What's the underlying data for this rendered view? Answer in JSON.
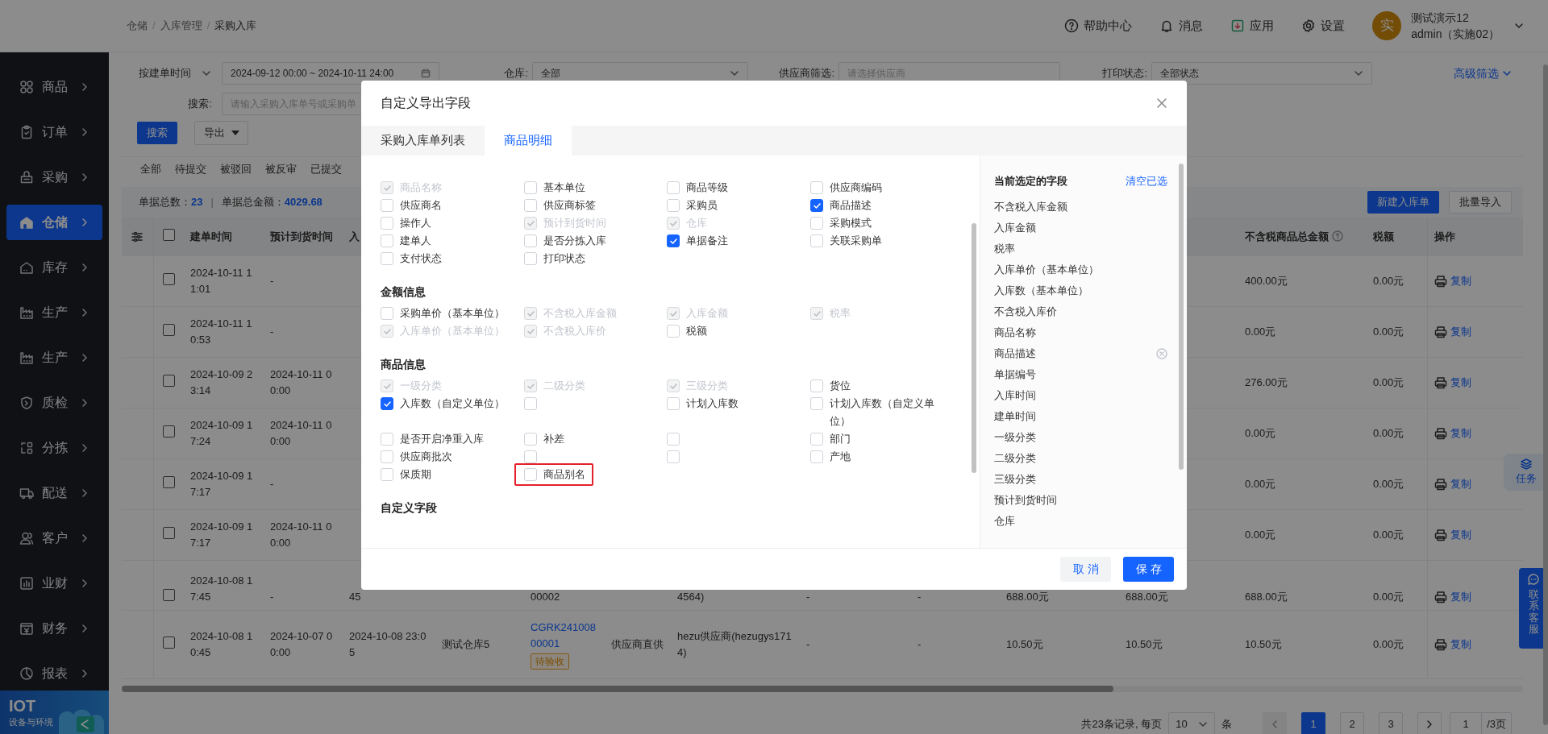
{
  "breadcrumb": {
    "items": [
      "仓储",
      "入库管理",
      "采购入库"
    ],
    "separator": "/"
  },
  "header_actions": [
    {
      "kind": "help",
      "label": "帮助中心"
    },
    {
      "kind": "bell",
      "label": "消息"
    },
    {
      "kind": "app",
      "label": "应用"
    },
    {
      "kind": "gear",
      "label": "设置"
    }
  ],
  "user": {
    "avatar": "实",
    "name": "测试演示12",
    "account": "admin（实施02）"
  },
  "sidebar": {
    "items": [
      {
        "kind": "grid",
        "label": "商品",
        "selected": false
      },
      {
        "kind": "clipboard",
        "label": "订单",
        "selected": false
      },
      {
        "kind": "basket",
        "label": "采购",
        "selected": false
      },
      {
        "kind": "warehouse",
        "label": "仓储",
        "selected": true
      },
      {
        "kind": "house",
        "label": "库存",
        "selected": false
      },
      {
        "kind": "factory",
        "label": "生产",
        "selected": false
      },
      {
        "kind": "factory",
        "label": "生产",
        "selected": false
      },
      {
        "kind": "shield",
        "label": "质检",
        "selected": false
      },
      {
        "kind": "sort",
        "label": "分拣",
        "selected": false
      },
      {
        "kind": "truck",
        "label": "配送",
        "selected": false
      },
      {
        "kind": "user",
        "label": "客户",
        "selected": false
      },
      {
        "kind": "chart",
        "label": "业财",
        "selected": false
      },
      {
        "kind": "ledger",
        "label": "财务",
        "selected": false
      },
      {
        "kind": "pie",
        "label": "报表",
        "selected": false
      }
    ],
    "banner": {
      "title": "IOT",
      "subtitle": "设备与环境"
    }
  },
  "filters": {
    "date_type": "按建单时间",
    "date_range": "2024-09-12 00:00 ~ 2024-10-11 24:00",
    "warehouse_label": "仓库:",
    "warehouse": "全部",
    "supplier_label": "供应商筛选:",
    "supplier_placeholder": "请选择供应商",
    "print_label": "打印状态:",
    "print_status": "全部状态",
    "advanced": "高级筛选",
    "search_label": "搜索:",
    "search_placeholder": "请输入采购入库单号或采购单"
  },
  "actions": {
    "search": "搜索",
    "export": "导出"
  },
  "status_tabs": [
    "全部",
    "待提交",
    "被驳回",
    "被反审",
    "已提交"
  ],
  "summary": {
    "count_label": "单据总数：",
    "count": "23",
    "separator": "|",
    "amount_label": "单据总金额：",
    "amount": "4029.68"
  },
  "toolbar_buttons": [
    {
      "kind": "primary",
      "label": "新建入库单"
    },
    {
      "kind": "secondary",
      "label": "批量导入"
    }
  ],
  "table": {
    "header_checked": false,
    "columns": [
      "建单时间",
      "预计到货时间",
      "入",
      null,
      null,
      null,
      null,
      null,
      null,
      null,
      null,
      {
        "label": "不含税商品总金额",
        "help": true
      },
      "税额",
      "操作"
    ],
    "rows": [
      {
        "checked": false,
        "partly_covered": false,
        "cells": [
          "2024-10-11 11:01",
          "-",
          null,
          null,
          null,
          null,
          null,
          null,
          null,
          null,
          null,
          "400.00元",
          "0.00元",
          "复制"
        ]
      },
      {
        "checked": false,
        "partly_covered": false,
        "cells": [
          "2024-10-11 10:53",
          "-",
          null,
          null,
          null,
          null,
          null,
          null,
          null,
          null,
          null,
          "0.00元",
          "0.00元",
          "复制"
        ]
      },
      {
        "checked": false,
        "partly_covered": false,
        "cells": [
          "2024-10-09 23:14",
          "2024-10-11 00:00",
          null,
          null,
          null,
          null,
          null,
          null,
          null,
          null,
          null,
          "276.00元",
          "0.00元",
          "复制"
        ]
      },
      {
        "checked": false,
        "partly_covered": false,
        "cells": [
          "2024-10-09 17:24",
          "2024-10-11 00:00",
          null,
          null,
          null,
          null,
          null,
          null,
          null,
          null,
          null,
          "0.00元",
          "0.00元",
          "复制"
        ]
      },
      {
        "checked": false,
        "partly_covered": false,
        "cells": [
          "2024-10-09 17:17",
          "-",
          null,
          null,
          null,
          null,
          null,
          null,
          null,
          null,
          null,
          "0.00元",
          "0.00元",
          "复制"
        ]
      },
      {
        "checked": false,
        "partly_covered": false,
        "cells": [
          "2024-10-09 17:17",
          "2024-10-11 00:00",
          null,
          null,
          null,
          null,
          null,
          null,
          null,
          null,
          null,
          "0.00元",
          "0.00元",
          "复制"
        ]
      },
      {
        "checked": false,
        "partly_covered": true,
        "cells": [
          "2024-10-08 17:45",
          "-",
          "45",
          null,
          "00002",
          null,
          "4564)",
          "-",
          "-",
          "688.00元",
          "688.00元",
          "688.00元",
          "0.00元",
          "复制"
        ]
      },
      {
        "checked": false,
        "partly_covered": false,
        "cells": [
          "2024-10-08 10:45",
          "2024-10-07 00:00",
          "2024-10-08 23:05",
          "测试仓库5",
          {
            "text": "CGRK24100800001",
            "badge": "待验收"
          },
          "供应商直供",
          "hezu供应商(hezugys1714)",
          "-",
          "-",
          "10.50元",
          "10.50元",
          "10.50元",
          "0.00元",
          "复制"
        ]
      }
    ]
  },
  "pagination": {
    "summary": "共23条记录, 每页",
    "page_size": "10",
    "unit": "条",
    "pages": [
      {
        "label": "1",
        "selected": true
      },
      {
        "label": "2",
        "selected": false
      },
      {
        "label": "3",
        "selected": false
      }
    ],
    "current": "1",
    "total": "/3页"
  },
  "floating": [
    {
      "kind": "task",
      "label": "任务"
    },
    {
      "kind": "contact",
      "label": "联系客服"
    }
  ],
  "modal": {
    "title": "自定义导出字段",
    "tabs": [
      {
        "label": "采购入库单列表",
        "selected": false
      },
      {
        "label": "商品明细",
        "selected": true
      }
    ],
    "sections": [
      {
        "fields": [
          {
            "label": "商品名称",
            "checked": true,
            "disabled": true
          },
          {
            "label": "基本单位",
            "checked": false,
            "disabled": false
          },
          {
            "label": "商品等级",
            "checked": false,
            "disabled": false
          },
          {
            "label": "供应商编码",
            "checked": false,
            "disabled": false
          },
          {
            "label": "供应商名",
            "checked": false,
            "disabled": false
          },
          {
            "label": "供应商标签",
            "checked": false,
            "disabled": false
          },
          {
            "label": "采购员",
            "checked": false,
            "disabled": false
          },
          {
            "label": "商品描述",
            "checked": true,
            "disabled": false
          },
          {
            "label": "操作人",
            "checked": false,
            "disabled": false
          },
          {
            "label": "预计到货时间",
            "checked": true,
            "disabled": true
          },
          {
            "label": "仓库",
            "checked": true,
            "disabled": true
          },
          {
            "label": "采购模式",
            "checked": false,
            "disabled": false
          },
          {
            "label": "建单人",
            "checked": false,
            "disabled": false
          },
          {
            "label": "是否分拣入库",
            "checked": false,
            "disabled": false
          },
          {
            "label": "单据备注",
            "checked": true,
            "disabled": false
          },
          {
            "label": "关联采购单",
            "checked": false,
            "disabled": false
          },
          {
            "label": "支付状态",
            "checked": false,
            "disabled": false
          },
          {
            "label": "打印状态",
            "checked": false,
            "disabled": false
          }
        ]
      },
      {
        "heading": "金额信息",
        "fields": [
          {
            "label": "采购单价（基本单位）",
            "checked": false,
            "disabled": false
          },
          {
            "label": "不含税入库金额",
            "checked": true,
            "disabled": true
          },
          {
            "label": "入库金额",
            "checked": true,
            "disabled": true
          },
          {
            "label": "税率",
            "checked": true,
            "disabled": true
          },
          {
            "label": "入库单价（基本单位）",
            "checked": true,
            "disabled": true
          },
          {
            "label": "不含税入库价",
            "checked": true,
            "disabled": true
          },
          {
            "label": "税额",
            "checked": false,
            "disabled": false
          }
        ]
      },
      {
        "heading": "商品信息",
        "fields": [
          {
            "label": "一级分类",
            "checked": true,
            "disabled": true
          },
          {
            "label": "二级分类",
            "checked": true,
            "disabled": true
          },
          {
            "label": "三级分类",
            "checked": true,
            "disabled": true
          },
          {
            "label": "货位",
            "checked": false,
            "disabled": false
          },
          {
            "label": "入库数（自定义单位）",
            "checked": true,
            "disabled": false
          },
          {
            "checked": false,
            "disabled": false
          },
          {
            "label": "计划入库数",
            "checked": false,
            "disabled": false
          },
          {
            "label": "计划入库数（自定义单位）",
            "checked": false,
            "disabled": false
          },
          {
            "label": "是否开启净重入库",
            "checked": false,
            "disabled": false
          },
          {
            "label": "补差",
            "checked": false,
            "disabled": false
          },
          {
            "checked": false,
            "disabled": false
          },
          {
            "label": "部门",
            "checked": false,
            "disabled": false
          },
          {
            "label": "供应商批次",
            "checked": false,
            "disabled": false
          },
          {
            "checked": false,
            "disabled": false
          },
          {
            "checked": false,
            "disabled": false
          },
          {
            "label": "产地",
            "checked": false,
            "disabled": false
          },
          {
            "label": "保质期",
            "checked": false,
            "disabled": false
          },
          {
            "label": "商品别名",
            "checked": false,
            "disabled": false,
            "highlighted": true
          }
        ]
      },
      {
        "heading": "自定义字段"
      }
    ],
    "selected_panel": {
      "title": "当前选定的字段",
      "clear": "清空已选",
      "items": [
        {
          "label": "不含税入库金额",
          "removable": false
        },
        {
          "label": "入库金额",
          "removable": false
        },
        {
          "label": "税率",
          "removable": false
        },
        {
          "label": "入库单价（基本单位）",
          "removable": false
        },
        {
          "label": "入库数（基本单位）",
          "removable": false
        },
        {
          "label": "不含税入库价",
          "removable": false
        },
        {
          "label": "商品名称",
          "removable": false
        },
        {
          "label": "商品描述",
          "removable": true
        },
        {
          "label": "单据编号",
          "removable": false
        },
        {
          "label": "入库时间",
          "removable": false
        },
        {
          "label": "建单时间",
          "removable": false
        },
        {
          "label": "一级分类",
          "removable": false
        },
        {
          "label": "二级分类",
          "removable": false
        },
        {
          "label": "三级分类",
          "removable": false
        },
        {
          "label": "预计到货时间",
          "removable": false
        },
        {
          "label": "仓库",
          "removable": false
        }
      ]
    },
    "buttons": [
      {
        "kind": "secondary",
        "label": "取消"
      },
      {
        "kind": "primary",
        "label": "保存"
      }
    ]
  }
}
